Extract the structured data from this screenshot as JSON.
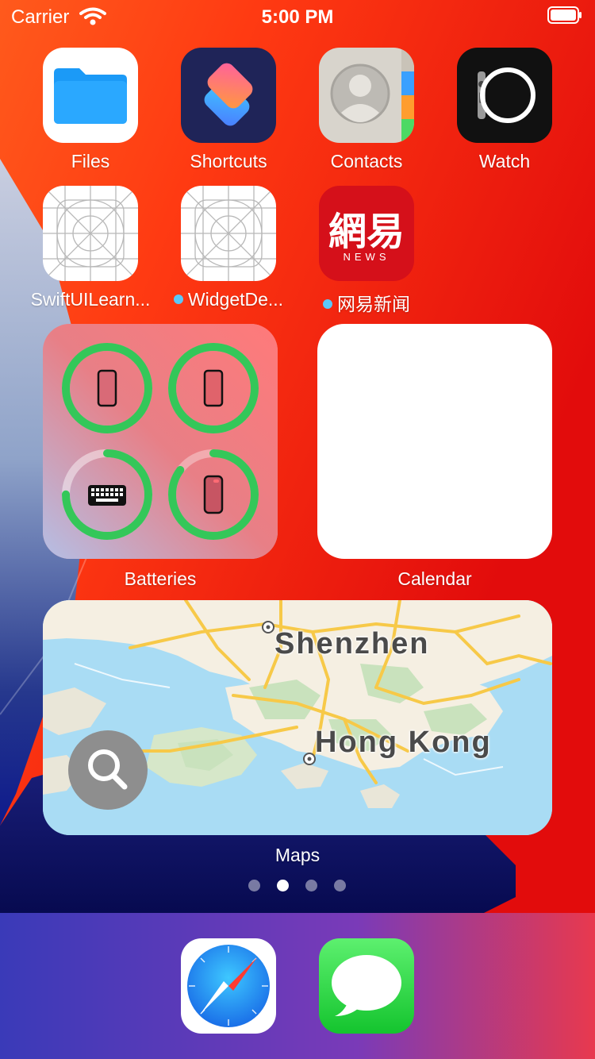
{
  "status_bar": {
    "carrier": "Carrier",
    "time": "5:00 PM"
  },
  "home_screen": {
    "row1": [
      {
        "label": "Files",
        "icon": "files-folder-icon"
      },
      {
        "label": "Shortcuts",
        "icon": "shortcuts-icon"
      },
      {
        "label": "Contacts",
        "icon": "contacts-icon"
      },
      {
        "label": "Watch",
        "icon": "watch-icon"
      }
    ],
    "row2": [
      {
        "label": "SwiftUILearn...",
        "icon": "placeholder-app-grid-icon",
        "new_dot": false
      },
      {
        "label": "WidgetDe...",
        "icon": "placeholder-app-grid-icon",
        "new_dot": true
      },
      {
        "label": "网易新闻",
        "icon": "netease-news-icon",
        "new_dot": true,
        "icon_text": "網易",
        "icon_subtext": "NEWS"
      }
    ]
  },
  "widgets": {
    "batteries": {
      "label": "Batteries",
      "devices": [
        {
          "device": "iphone",
          "charge_fraction": 1.0
        },
        {
          "device": "iphone",
          "charge_fraction": 1.0
        },
        {
          "device": "keyboard",
          "charge_fraction": 0.75
        },
        {
          "device": "iphone",
          "charge_fraction": 0.85
        }
      ],
      "ring_color": "#34c759"
    },
    "calendar": {
      "label": "Calendar"
    },
    "maps": {
      "label": "Maps",
      "places": [
        "Shenzhen",
        "Hong Kong"
      ]
    }
  },
  "page_indicator": {
    "pages": 4,
    "current": 2
  },
  "dock": {
    "apps": [
      {
        "name": "Safari",
        "icon": "safari-compass-icon"
      },
      {
        "name": "Messages",
        "icon": "messages-bubble-icon"
      }
    ]
  },
  "colors": {
    "wallpaper_red": "#e8100f",
    "wallpaper_orange": "#ff6d1a",
    "wallpaper_navy": "#0e1a8c",
    "map_water": "#a9dcf4",
    "map_land": "#f5efe2",
    "map_green": "#c9e2bd",
    "map_road": "#f7c948"
  }
}
